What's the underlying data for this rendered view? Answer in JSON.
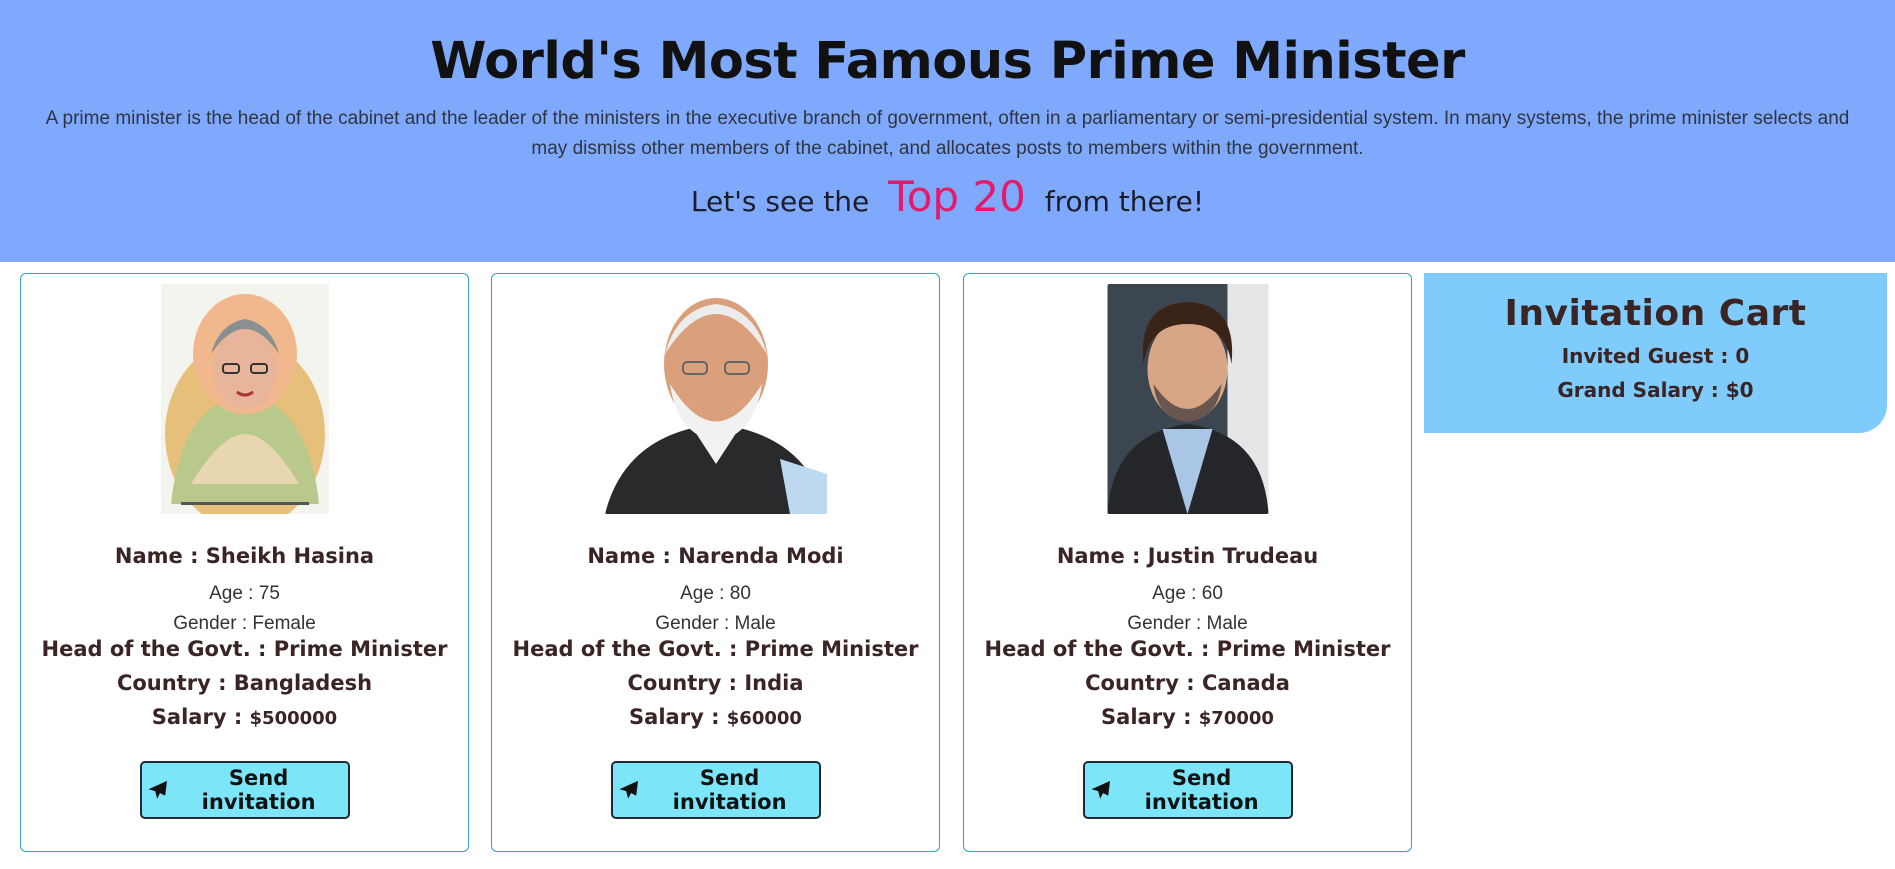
{
  "hero": {
    "title": "World's Most Famous Prime Minister",
    "description": "A prime minister is the head of the cabinet and the leader of the ministers in the executive branch of government, often in a parliamentary or semi-presidential system. In many systems, the prime minister selects and may dismiss other members of the cabinet, and allocates posts to members within the government.",
    "sub_prefix": "Let's see the",
    "sub_highlight": "Top 20",
    "sub_suffix": "from there!",
    "highlight_color": "#e41b6a",
    "background_color": "#7fa9fd"
  },
  "labels": {
    "name": "Name : ",
    "age": "Age : ",
    "gender": "Gender : ",
    "head": "Head of the Govt. : ",
    "country": "Country : ",
    "salary": "Salary : ",
    "button": "Send invitation",
    "button_icon": "paper-plane-icon"
  },
  "cards": [
    {
      "name": "Sheikh Hasina",
      "age": "75",
      "gender": "Female",
      "head": "Prime Minister",
      "country": "Bangladesh",
      "salary": "$500000"
    },
    {
      "name": "Narenda Modi",
      "age": "80",
      "gender": "Male",
      "head": "Prime Minister",
      "country": "India",
      "salary": "$60000"
    },
    {
      "name": "Justin Trudeau",
      "age": "60",
      "gender": "Male",
      "head": "Prime Minister",
      "country": "Canada",
      "salary": "$70000"
    }
  ],
  "cart": {
    "title": "Invitation Cart",
    "guest_label": "Invited Guest : ",
    "guest_count": "0",
    "salary_label": "Grand Salary : ",
    "salary_value": "$0",
    "background_color": "#7fcbfc"
  }
}
